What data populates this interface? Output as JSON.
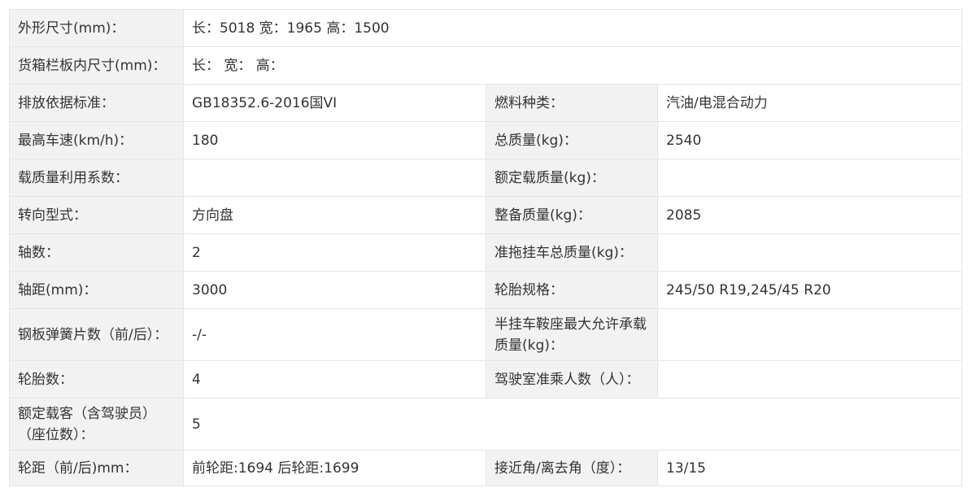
{
  "rows": {
    "r0": {
      "label": "外形尺寸(mm)：",
      "value": "长：5018 宽：1965 高：1500"
    },
    "r1": {
      "label": "货箱栏板内尺寸(mm)：",
      "value": "长：  宽：  高："
    },
    "r2": {
      "label1": "排放依据标准：",
      "value1": "GB18352.6-2016国VI",
      "label2": "燃料种类：",
      "value2": "汽油/电混合动力"
    },
    "r3": {
      "label1": "最高车速(km/h)：",
      "value1": "180",
      "label2": "总质量(kg)：",
      "value2": "2540"
    },
    "r4": {
      "label1": "载质量利用系数：",
      "value1": "",
      "label2": "额定载质量(kg)：",
      "value2": ""
    },
    "r5": {
      "label1": "转向型式：",
      "value1": "方向盘",
      "label2": "整备质量(kg)：",
      "value2": "2085"
    },
    "r6": {
      "label1": "轴数：",
      "value1": "2",
      "label2": "准拖挂车总质量(kg)：",
      "value2": ""
    },
    "r7": {
      "label1": "轴距(mm)：",
      "value1": "3000",
      "label2": "轮胎规格：",
      "value2": "245/50 R19,245/45 R20"
    },
    "r8": {
      "label1": "钢板弹簧片数（前/后）：",
      "value1": "-/-",
      "label2_line1": "半挂车鞍座最大允许承载",
      "label2_line2": "质量(kg)：",
      "value2": ""
    },
    "r9": {
      "label1": "轮胎数：",
      "value1": "4",
      "label2": "驾驶室准乘人数（人）：",
      "value2": ""
    },
    "r10": {
      "label_line1": "额定载客（含驾驶员）",
      "label_line2": "（座位数）：",
      "value": "5"
    },
    "r11": {
      "label1": "轮距（前/后)mm：",
      "value1": "前轮距:1694 后轮距:1699",
      "label2": "接近角/离去角（度）：",
      "value2": "13/15"
    }
  }
}
